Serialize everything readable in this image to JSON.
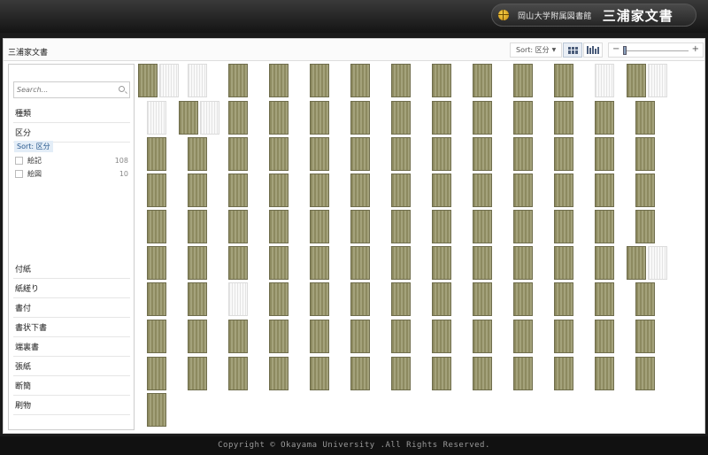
{
  "header": {
    "university": "岡山大学附属図書館",
    "collection_title": "三浦家文書",
    "icon": "globe-icon"
  },
  "toolbar": {
    "page_title": "三浦家文書",
    "sort_label": "Sort: 区分",
    "grid_view_icon": "grid-view-icon",
    "bar_view_icon": "bar-chart-view-icon",
    "zoom_minus": "−",
    "zoom_plus": "+",
    "zoom_level": 0.05
  },
  "sidebar": {
    "search_placeholder": "Search...",
    "facets_top": [
      "種類",
      "区分"
    ],
    "sort_tag": "Sort: 区分",
    "options": [
      {
        "label": "絵記",
        "count": "108"
      },
      {
        "label": "絵図",
        "count": "10"
      }
    ],
    "facets_bottom": [
      "付紙",
      "紙縒り",
      "書付",
      "書状下書",
      "端裏書",
      "張紙",
      "断簡",
      "刷物"
    ]
  },
  "footer": {
    "copyright": "Copyright © Okayama University .All Rights Reserved."
  }
}
